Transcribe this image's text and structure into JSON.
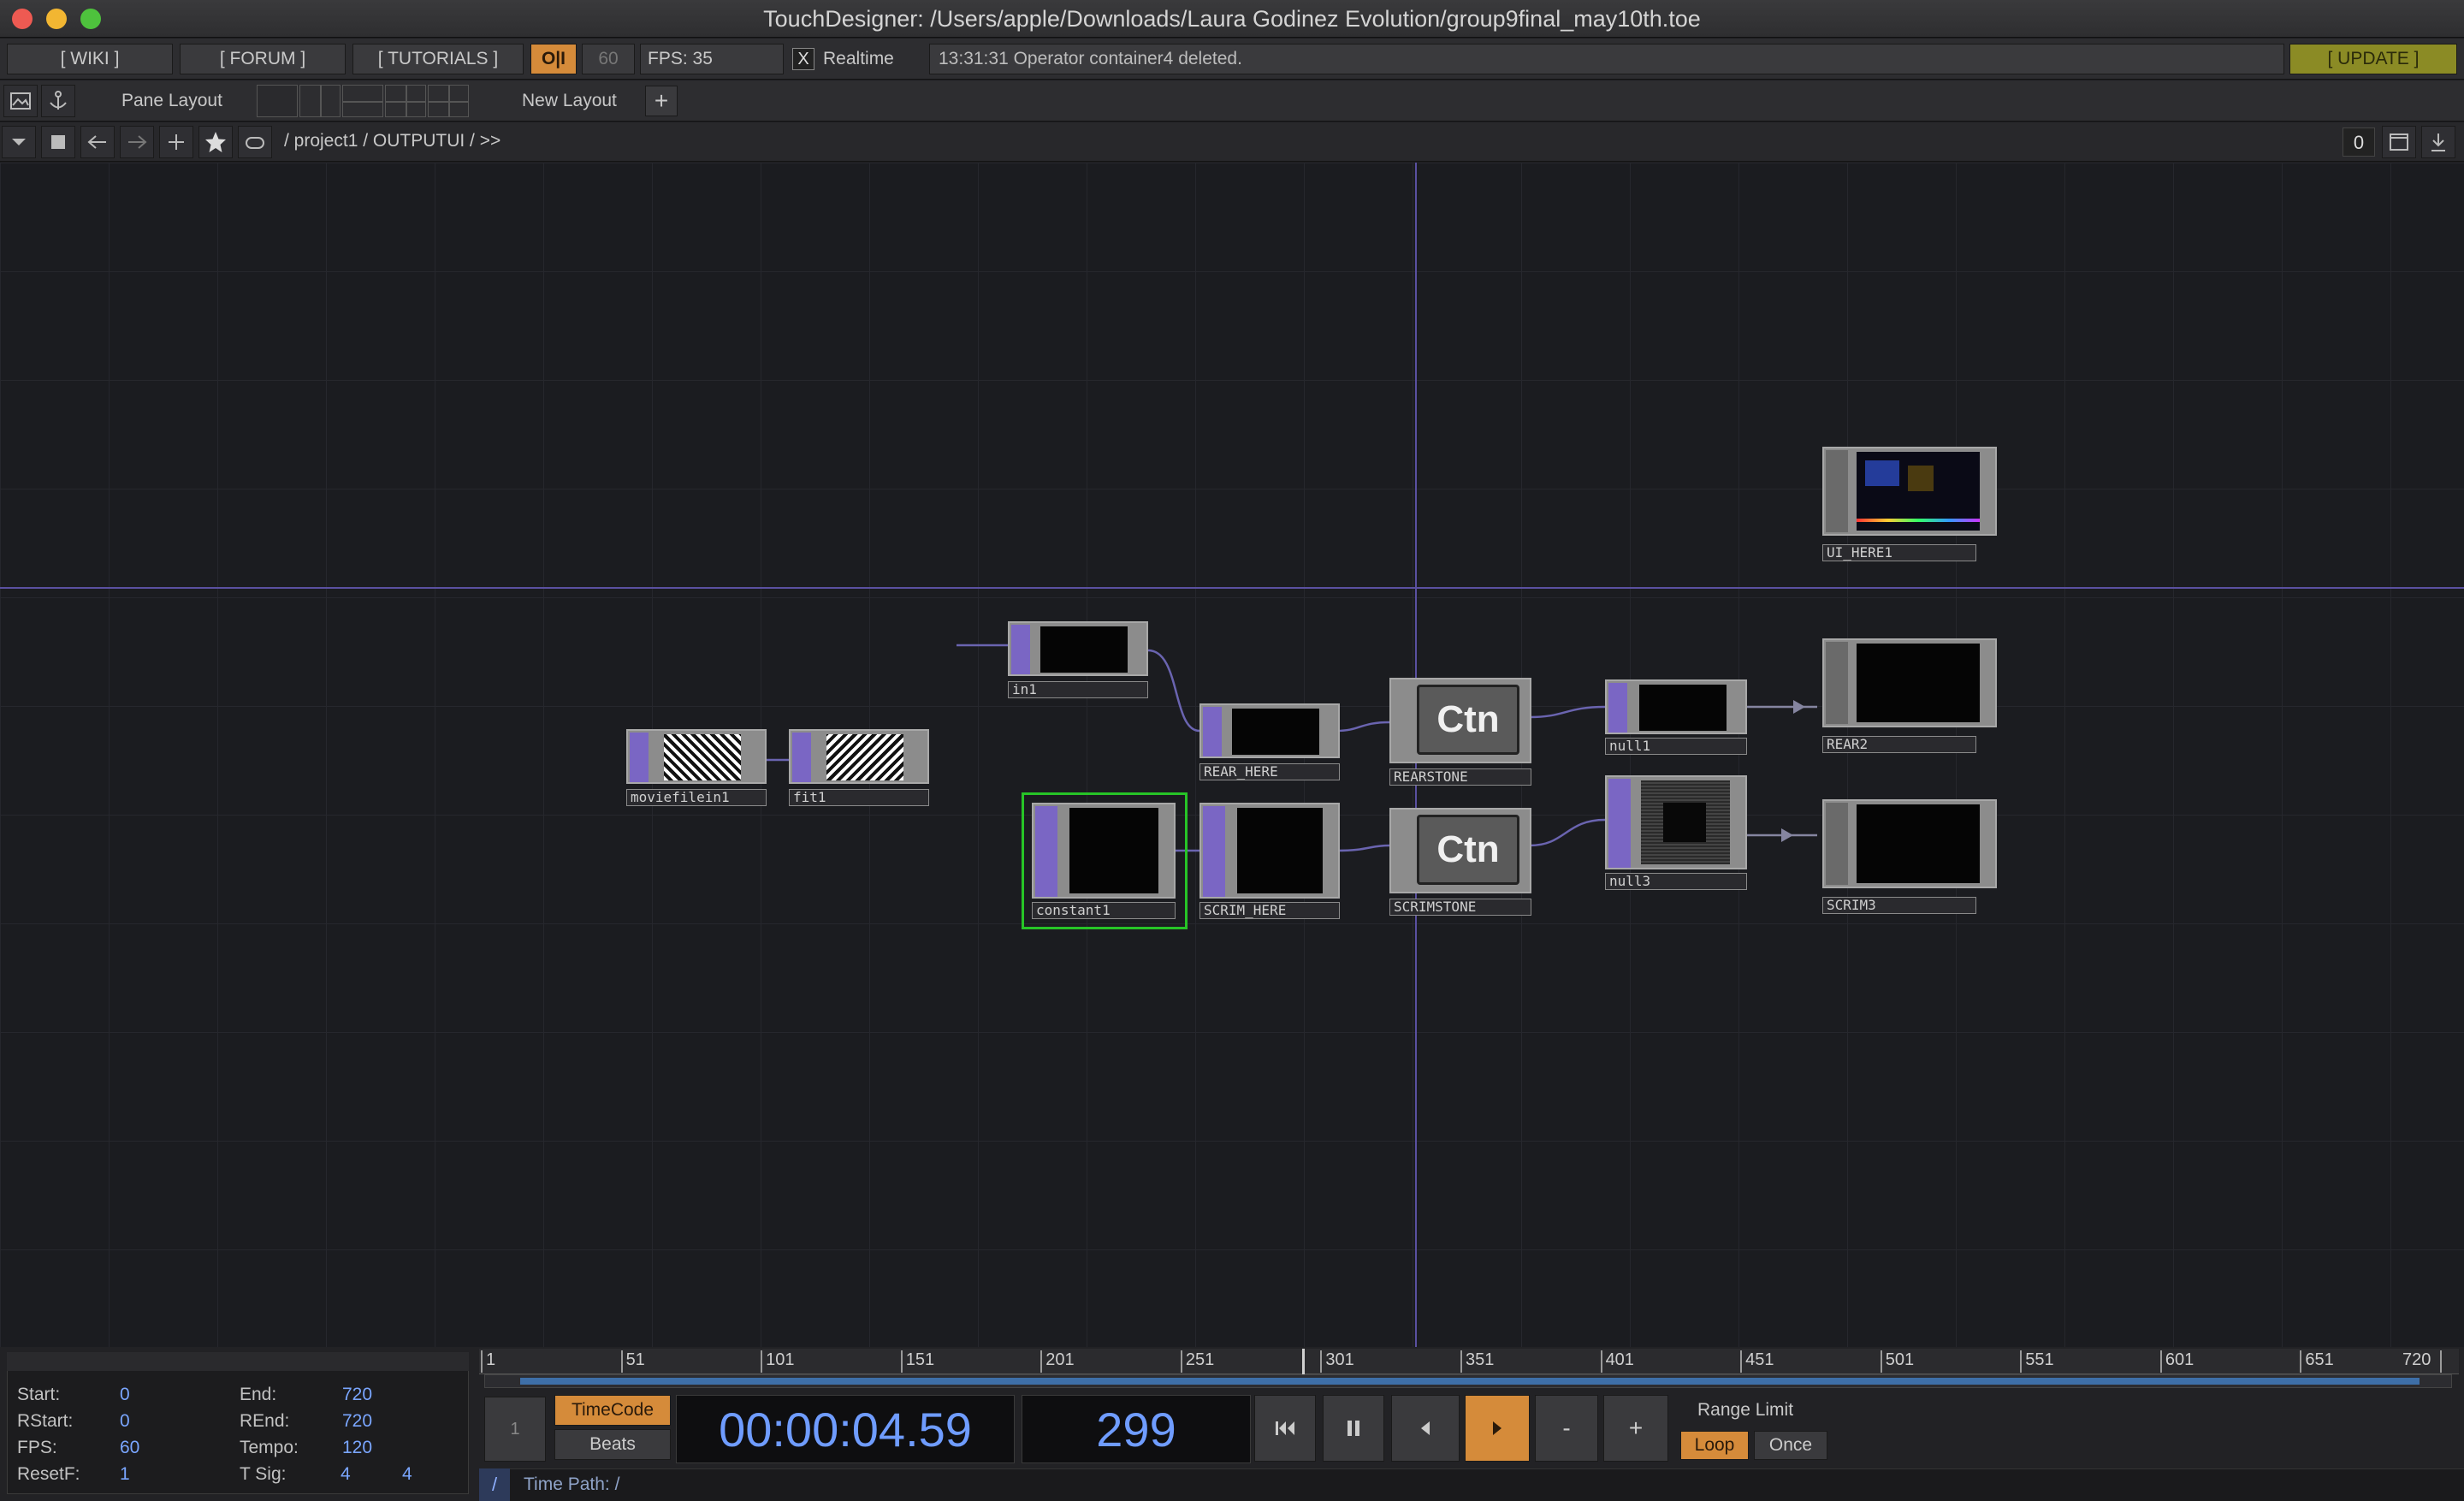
{
  "window": {
    "title": "TouchDesigner: /Users/apple/Downloads/Laura Godinez Evolution/group9final_may10th.toe"
  },
  "toolbar": {
    "wiki": "[ WIKI ]",
    "forum": "[ FORUM ]",
    "tutorials": "[ TUTORIALS ]",
    "oi": "O|I",
    "fps_target": "60",
    "fps_label": "FPS:  35",
    "realtime_check": "X",
    "realtime": "Realtime",
    "status": "13:31:31 Operator container4 deleted.",
    "update": "[ UPDATE ]"
  },
  "pane_bar": {
    "pane_layout": "Pane Layout",
    "new_layout": "New Layout",
    "add": "+"
  },
  "nav_bar": {
    "path": "/ project1 / OUTPUTUI / >>",
    "counter": "0"
  },
  "nodes": [
    {
      "id": "moviefilein1",
      "label": "moviefilein1"
    },
    {
      "id": "fit1",
      "label": "fit1"
    },
    {
      "id": "in1",
      "label": "in1"
    },
    {
      "id": "rear_here",
      "label": "REAR_HERE"
    },
    {
      "id": "constant1",
      "label": "constant1"
    },
    {
      "id": "scrim_here",
      "label": "SCRIM_HERE"
    },
    {
      "id": "rearstone",
      "label": "REARSTONE",
      "text": "Ctn"
    },
    {
      "id": "scrimstone",
      "label": "SCRIMSTONE",
      "text": "Ctn"
    },
    {
      "id": "null1",
      "label": "null1"
    },
    {
      "id": "null3",
      "label": "null3"
    },
    {
      "id": "ui_here1",
      "label": "UI_HERE1"
    },
    {
      "id": "rear2",
      "label": "REAR2"
    },
    {
      "id": "scrim3",
      "label": "SCRIM3"
    }
  ],
  "timeline": {
    "ticks": [
      "1",
      "51",
      "101",
      "151",
      "201",
      "251",
      "301",
      "351",
      "401",
      "451",
      "501",
      "551",
      "601",
      "651",
      "720"
    ],
    "settings": {
      "start_label": "Start:",
      "start": "0",
      "end_label": "End:",
      "end": "720",
      "rstart_label": "RStart:",
      "rstart": "0",
      "rend_label": "REnd:",
      "rend": "720",
      "fps_label": "FPS:",
      "fps": "60",
      "tempo_label": "Tempo:",
      "tempo": "120",
      "resetf_label": "ResetF:",
      "resetf": "1",
      "tsig_label": "T Sig:",
      "tsig_a": "4",
      "tsig_b": "4"
    },
    "side_num": "1",
    "timecode_btn": "TimeCode",
    "beats_btn": "Beats",
    "timecode": "00:00:04.59",
    "frame": "299",
    "range_limit": "Range Limit",
    "loop": "Loop",
    "once": "Once",
    "minus": "-",
    "plus": "+",
    "time_path_slash": "/",
    "time_path": "Time Path: /"
  },
  "colors": {
    "accent_orange": "#d58b3a",
    "op_purple": "#7a66c4",
    "selected_green": "#27c427",
    "update_olive": "#8b8b25",
    "value_blue": "#7aa6ff"
  }
}
